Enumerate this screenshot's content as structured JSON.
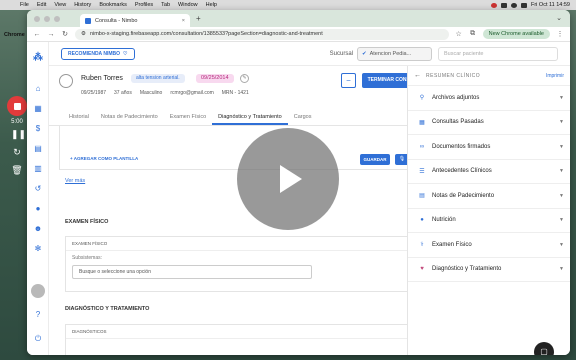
{
  "menubar": {
    "app": "Chrome",
    "menus": [
      "File",
      "Edit",
      "View",
      "History",
      "Bookmarks",
      "Profiles",
      "Tab",
      "Window",
      "Help"
    ],
    "clock": "Fri Oct 11  14:59"
  },
  "recorder": {
    "time": "5:00"
  },
  "browser": {
    "tab_title": "Consulta - Nimbo",
    "url": "nimbo-x-staging.firebaseapp.com/consultation/1385533?pageSection=diagnostic-and-treatment",
    "chrome_available": "New Chrome available"
  },
  "topbar": {
    "recommend_label": "RECOMIENDA NIMBO",
    "sucursal_label": "Sucursal",
    "sucursal_value": "Atencion Pedia...",
    "search_placeholder": "Buscar paciente"
  },
  "patient": {
    "name": "Ruben Torres",
    "tag": "alta tension arterial.",
    "date_tag": "09/25/2014",
    "birthdate": "09/25/1987",
    "age": "37 años",
    "sex": "Masculino",
    "email": "rcmrgo@gmail.com",
    "mrn": "MRN - 1421",
    "finish_button": "TERMINAR CONSULTA",
    "minus_button": "−"
  },
  "tabs": [
    {
      "label": "Historial"
    },
    {
      "label": "Notas de Padecimiento"
    },
    {
      "label": "Examen Físico"
    },
    {
      "label": "Diagnóstico y Tratamiento"
    },
    {
      "label": "Cargos"
    }
  ],
  "main": {
    "template_link": "+ AGREGAR COMO PLANTILLA",
    "save_button": "GUARDAR",
    "ver_mas": "Ver más",
    "exam_title": "EXAMEN FÍSICO",
    "exam_card_header": "EXAMEN FÍSICO",
    "subsystems_label": "Subsistemas:",
    "subsystems_placeholder": "Busque o seleccione una opción",
    "dx_title": "DIAGNÓSTICO Y TRATAMIENTO",
    "dx_card_header": "DIAGNÓSTICOS"
  },
  "right_panel": {
    "title": "RESUMEN CLÍNICO",
    "print": "Imprimir",
    "items": [
      {
        "label": "Archivos adjuntos",
        "icon": "paperclip-icon"
      },
      {
        "label": "Consultas Pasadas",
        "icon": "calendar-icon"
      },
      {
        "label": "Documentos firmados",
        "icon": "link-icon"
      },
      {
        "label": "Antecedentes Clínicos",
        "icon": "list-icon"
      },
      {
        "label": "Notas de Padecimiento",
        "icon": "note-icon"
      },
      {
        "label": "Nutrición",
        "icon": "apple-icon"
      },
      {
        "label": "Examen Físico",
        "icon": "stethoscope-icon"
      },
      {
        "label": "Diagnóstico y Tratamiento",
        "icon": "heart-icon"
      }
    ]
  }
}
